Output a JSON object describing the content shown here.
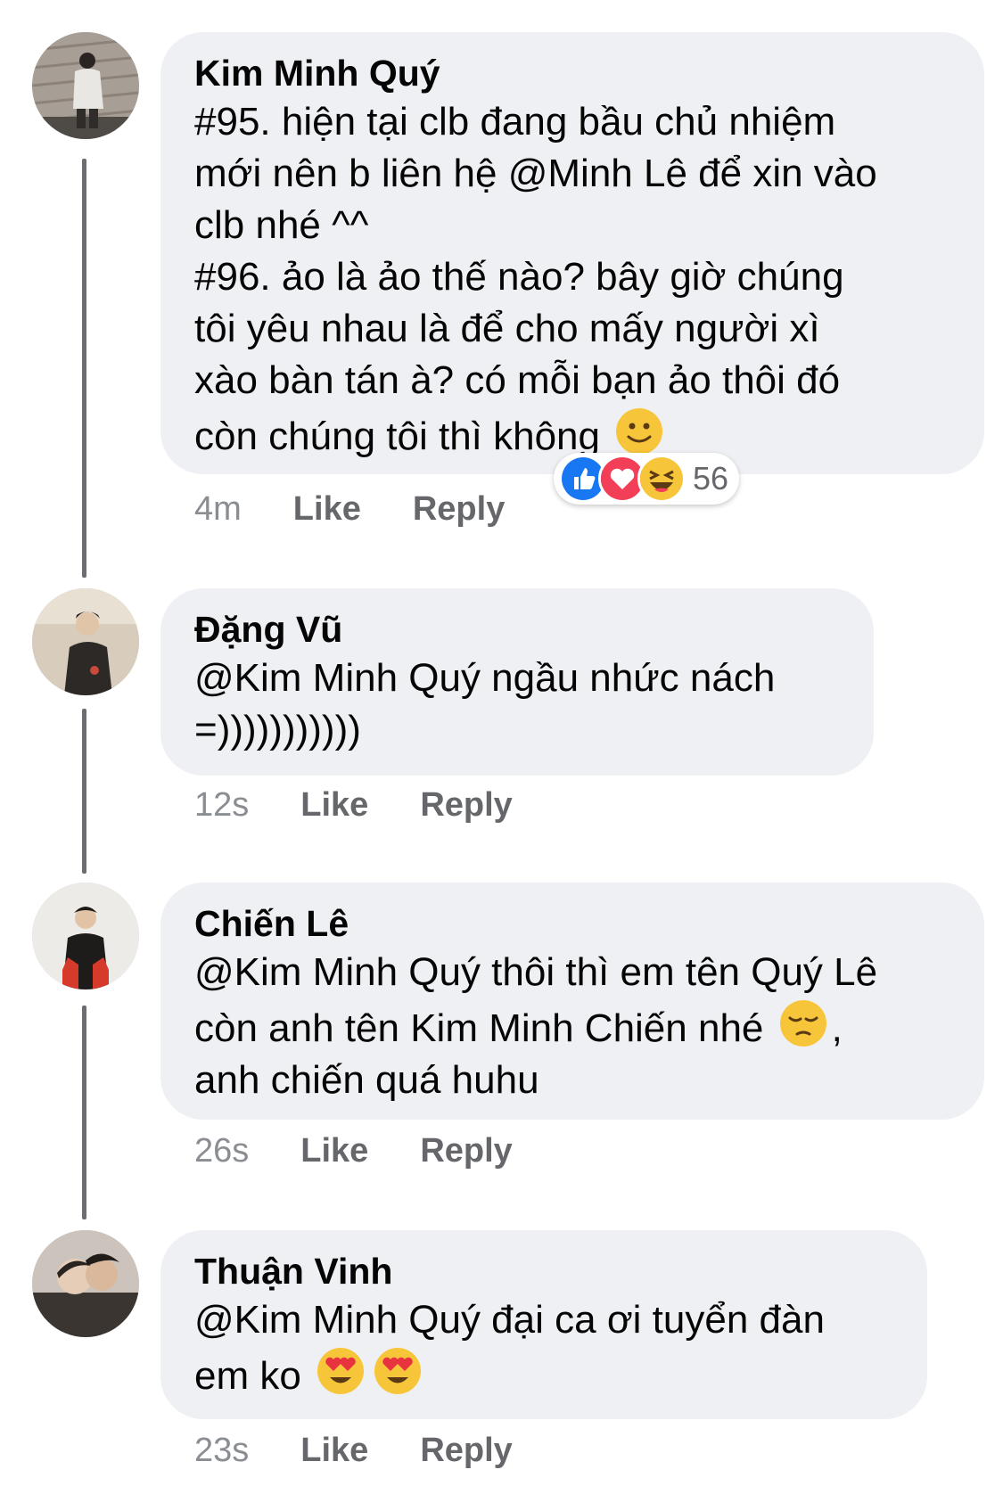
{
  "comments": [
    {
      "author": "Kim Minh Quý",
      "lines": [
        "#95. hiện tại clb đang bầu chủ nhiệm",
        "mới nên b liên hệ @Minh Lê để xin vào",
        "clb nhé ^^",
        "#96. ảo là ảo thế nào? bây giờ chúng",
        "tôi yêu nhau là để cho mấy người xì",
        "xào bàn tán à? có mỗi bạn ảo thôi đó",
        "còn chúng tôi thì không"
      ],
      "trailing_emoji": "slightly-smiling-face-icon",
      "time": "4m",
      "like_label": "Like",
      "reply_label": "Reply",
      "reactions": {
        "icons": [
          "like-reaction-icon",
          "love-reaction-icon",
          "haha-reaction-icon"
        ],
        "count": "56"
      }
    },
    {
      "author": "Đặng Vũ",
      "lines": [
        "@Kim Minh Quý ngầu nhức nách",
        "=)))))))))))"
      ],
      "time": "12s",
      "like_label": "Like",
      "reply_label": "Reply"
    },
    {
      "author": "Chiến Lê",
      "lines": [
        "@Kim Minh Quý thôi thì em tên Quý Lê",
        "còn anh tên Kim Minh Chiến nhé",
        "anh chiến quá huhu"
      ],
      "line2_suffix": ",",
      "inline_emoji": "pensive-face-icon",
      "time": "26s",
      "like_label": "Like",
      "reply_label": "Reply"
    },
    {
      "author": "Thuận Vinh",
      "lines": [
        "@Kim Minh Quý đại ca ơi tuyển đàn",
        "em ko"
      ],
      "inline_emoji": "heart-eyes-face-icon",
      "time": "23s",
      "like_label": "Like",
      "reply_label": "Reply"
    }
  ],
  "colors": {
    "bubble": "#eff0f3",
    "meta_text": "#65676b",
    "like_blue": "#1877f2",
    "love_red": "#f33e58",
    "emoji_yellow": "#f7c53a"
  }
}
